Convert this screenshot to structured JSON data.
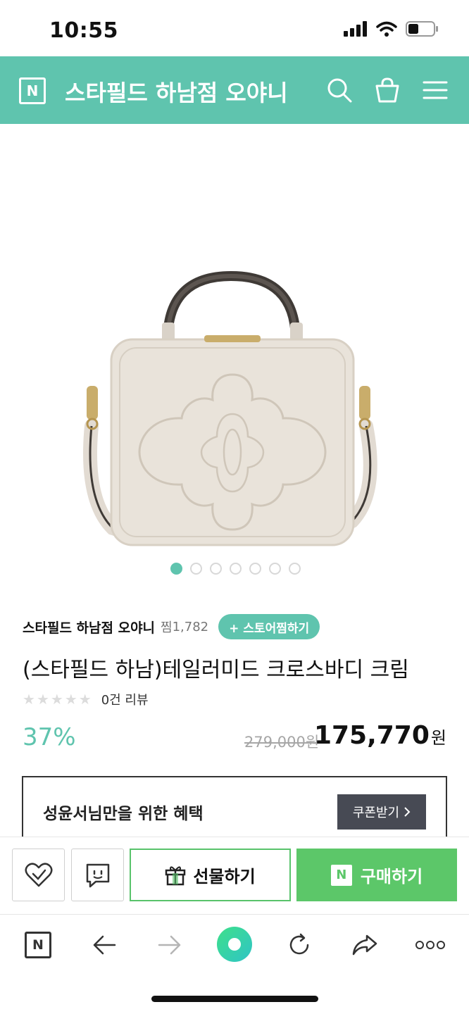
{
  "status_bar": {
    "time": "10:55"
  },
  "header": {
    "logo_letter": "N",
    "store_title": "스타필드 하남점 오야니",
    "accent_color": "#5fc4ae"
  },
  "gallery": {
    "total_images": 7,
    "active_index": 0
  },
  "product": {
    "store_name": "스타필드 하남점 오야니",
    "zzim_label": "찜",
    "zzim_count": "1,782",
    "store_zzim_button": "+ 스토어찜하기",
    "title": "(스타필드 하남)테일러미드 크로스바디 크림",
    "rating_stars": 0,
    "review_text": "0건 리뷰",
    "discount": "37%",
    "original_price": "279,000원",
    "sale_price": "175,770",
    "currency": "원"
  },
  "benefit": {
    "title": "성윤서님만을 위한 혜택",
    "coupon_button": "쿠폰받기"
  },
  "purchase_bar": {
    "gift_label": "선물하기",
    "buy_logo": "N",
    "buy_label": "구매하기",
    "buy_color": "#5cc769"
  },
  "browser_toolbar": {
    "logo_letter": "N"
  },
  "icons": {
    "search": "search-icon",
    "cart": "shopping-bag-icon",
    "menu": "hamburger-menu-icon",
    "like": "heart-check-icon",
    "talk": "talk-bubble-icon",
    "gift": "gift-icon",
    "back": "arrow-left-icon",
    "forward": "arrow-right-icon",
    "home": "green-dot-icon",
    "reload": "reload-icon",
    "share": "share-icon",
    "more": "more-dots-icon"
  }
}
